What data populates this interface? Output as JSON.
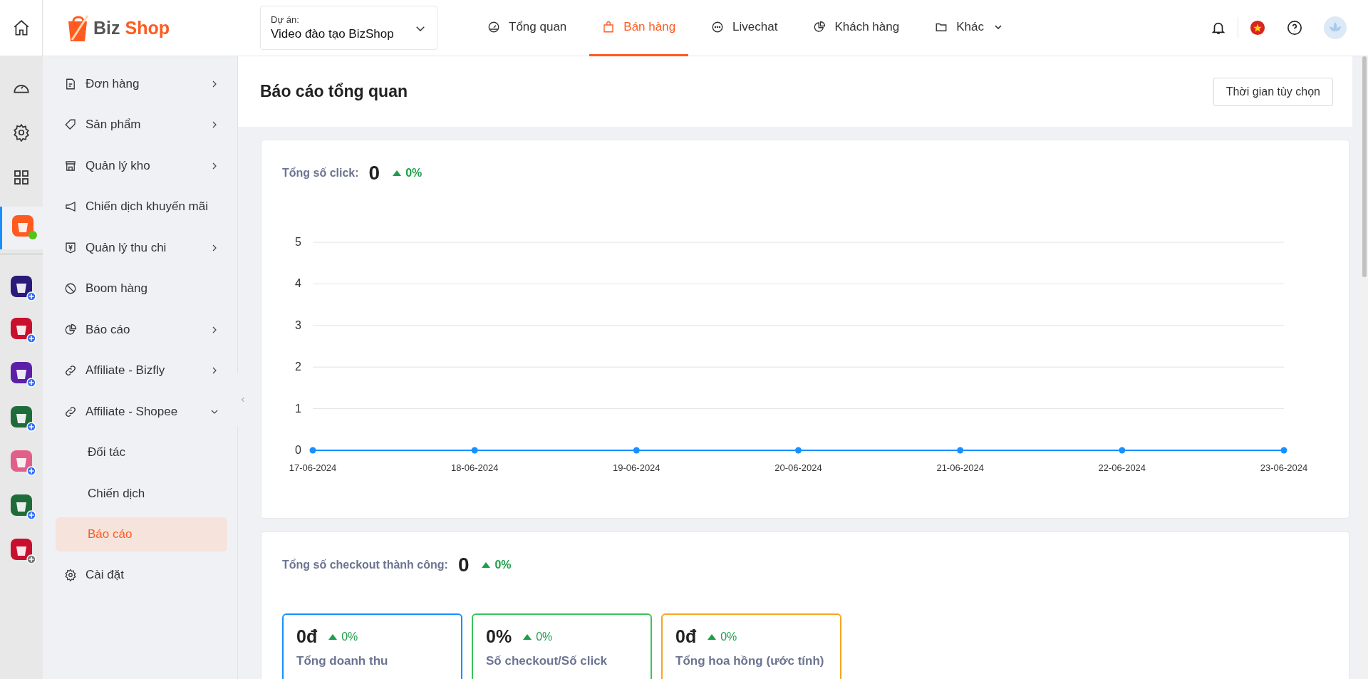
{
  "topbar": {
    "brand": {
      "part_1": "Biz",
      "part_2": "Shop"
    },
    "project": {
      "label": "Dự án:",
      "value": "Video đào tạo BizShop"
    },
    "tabs": [
      {
        "label": "Tổng quan",
        "selected": false
      },
      {
        "label": "Bán hàng",
        "selected": true
      },
      {
        "label": "Livechat",
        "selected": false
      },
      {
        "label": "Khách hàng",
        "selected": false
      },
      {
        "label": "Khác",
        "selected": false
      }
    ]
  },
  "app_rail": {
    "apps": [
      {
        "color": "#ff5a1f",
        "selected": true,
        "online": true,
        "disabled": false
      },
      {
        "color": "#2a1a7a",
        "selected": false,
        "online": false,
        "disabled": false
      },
      {
        "color": "#c8102e",
        "selected": false,
        "online": false,
        "disabled": false
      },
      {
        "color": "#5b1fa8",
        "selected": false,
        "online": false,
        "disabled": false
      },
      {
        "color": "#1f6b3a",
        "selected": false,
        "online": false,
        "disabled": false
      },
      {
        "color": "#e0608a",
        "selected": false,
        "online": false,
        "disabled": false
      },
      {
        "color": "#1f6b3a",
        "selected": false,
        "online": false,
        "disabled": false
      },
      {
        "color": "#c8102e",
        "selected": false,
        "online": false,
        "disabled": true
      }
    ]
  },
  "sidebar": {
    "items": [
      {
        "label": "Đơn hàng",
        "kind": "group",
        "expanded": false
      },
      {
        "label": "Sản phẩm",
        "kind": "group",
        "expanded": false
      },
      {
        "label": "Quản lý kho",
        "kind": "group",
        "expanded": false
      },
      {
        "label": "Chiến dịch khuyến mãi",
        "kind": "link"
      },
      {
        "label": "Quản lý thu chi",
        "kind": "group",
        "expanded": false
      },
      {
        "label": "Boom hàng",
        "kind": "link"
      },
      {
        "label": "Báo cáo",
        "kind": "group",
        "expanded": false
      },
      {
        "label": "Affiliate - Bizfly",
        "kind": "group",
        "expanded": false
      },
      {
        "label": "Affiliate - Shopee",
        "kind": "group",
        "expanded": true,
        "children": [
          {
            "label": "Đối tác",
            "selected": false
          },
          {
            "label": "Chiến dịch",
            "selected": false
          },
          {
            "label": "Báo cáo",
            "selected": true
          }
        ]
      },
      {
        "label": "Cài đặt",
        "kind": "link"
      }
    ]
  },
  "page": {
    "title": "Báo cáo tổng quan",
    "time_button": "Thời gian tùy chọn"
  },
  "clicks": {
    "label": "Tổng số click:",
    "value": "0",
    "change": "0%",
    "chart_data": {
      "type": "line",
      "categories": [
        "17-06-2024",
        "18-06-2024",
        "19-06-2024",
        "20-06-2024",
        "21-06-2024",
        "22-06-2024",
        "23-06-2024"
      ],
      "series": [
        {
          "color": "#1890ff",
          "marker": true,
          "values": [
            0,
            0,
            0,
            0,
            0,
            0,
            0
          ]
        }
      ],
      "ylim": [
        0,
        5
      ],
      "yticks": [
        0,
        1,
        2,
        3,
        4,
        5
      ],
      "grid": true
    }
  },
  "checkout": {
    "label": "Tổng số checkout thành công:",
    "value": "0",
    "change": "0%",
    "metrics": [
      {
        "value": "0đ",
        "change": "0%",
        "label": "Tổng doanh thu",
        "color": "#1890ff"
      },
      {
        "value": "0%",
        "change": "0%",
        "label": "Số checkout/Số click",
        "color": "#3cc35a"
      },
      {
        "value": "0đ",
        "change": "0%",
        "label": "Tổng hoa hồng (ước tính)",
        "color": "#f5a623"
      }
    ]
  }
}
